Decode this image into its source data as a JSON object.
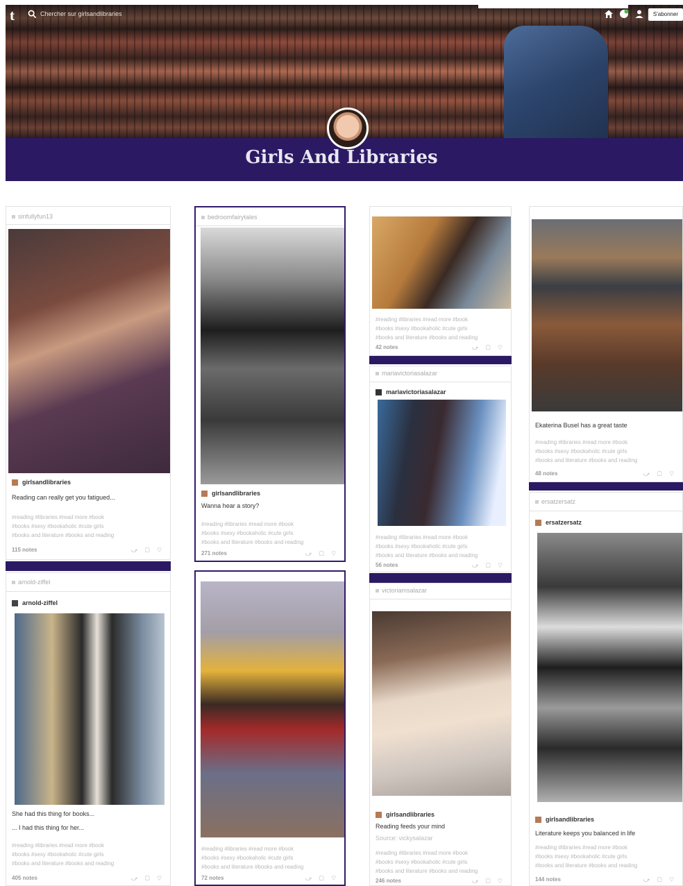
{
  "header": {
    "logo": "t",
    "search_placeholder": "Chercher sur girlsandlibraries",
    "subscribe_label": "S'abonner",
    "blog_title": "Girls And Libraries",
    "nav_icons": [
      "home-icon",
      "badge-icon",
      "account-icon"
    ]
  },
  "colors": {
    "accent": "#2b1a63",
    "post_border": "#311a6a",
    "tag": "#b8b8b8"
  },
  "posts": [
    {
      "source": "sinfullyfun13",
      "author": "girlsandlibraries",
      "text": "Reading can really get you fatigued...",
      "tags": [
        "#reading  #libraries  #read more  #book",
        "#books  #sexy  #bookaholic  #cute girls",
        "#books and literature  #books and reading"
      ],
      "notes": "115 notes"
    },
    {
      "source": "bedroomfairytales",
      "author": "girlsandlibraries",
      "text": "Wanna hear a story?",
      "tags": [
        "#reading  #libraries  #read more  #book",
        "#books  #sexy  #bookaholic  #cute girls",
        "#books and literature  #books and reading"
      ],
      "notes": "271 notes"
    },
    {
      "tags": [
        "#reading  #libraries  #read more  #book",
        "#books  #sexy  #bookaholic  #cute girls",
        "#books and literature  #books and reading"
      ],
      "notes": "42 notes"
    },
    {
      "text": "Ekaterina Busel has a great taste",
      "tags": [
        "#reading  #libraries  #read more  #book",
        "#books  #sexy  #bookaholic  #cute girls",
        "#books and literature  #books and reading"
      ],
      "notes": "48 notes"
    },
    {
      "source": "mariavictoriasalazar",
      "author": "mariavictoriasalazar",
      "tags": [
        "#reading  #libraries  #read more  #book",
        "#books  #sexy  #bookaholic  #cute girls",
        "#books and literature  #books and reading"
      ],
      "notes": "56 notes"
    },
    {
      "source": "ersatzersatz",
      "author": "ersatzersatz",
      "text": "Literature keeps you balanced in life",
      "tags": [
        "#reading  #libraries  #read more  #book",
        "#books  #sexy  #bookaholic  #cute girls",
        "#books and literature  #books and reading"
      ],
      "notes": "144 notes"
    },
    {
      "source": "arnold-ziffel",
      "author": "arnold-ziffel",
      "text": "She had this thing for books...",
      "text2": "... I had this thing for her...",
      "tags": [
        "#reading  #libraries  #read more  #book",
        "#books  #sexy  #bookaholic  #cute girls",
        "#books and literature  #books and reading"
      ],
      "notes": "405 notes"
    },
    {
      "tags": [
        "#reading  #libraries  #read more  #book",
        "#books  #sexy  #bookaholic  #cute girls",
        "#books and literature  #books and reading"
      ],
      "notes": "72 notes"
    },
    {
      "source": "victoriamsalazar",
      "author": "girlsandlibraries",
      "text": "Reading feeds your mind",
      "text2": "Source: vickysalazar",
      "tags": [
        "#reading  #libraries  #read more  #book",
        "#books  #sexy  #bookaholic  #cute girls",
        "#books and literature  #books and reading"
      ],
      "notes": "246 notes"
    }
  ],
  "actions": "⤻ ▢ ♡"
}
